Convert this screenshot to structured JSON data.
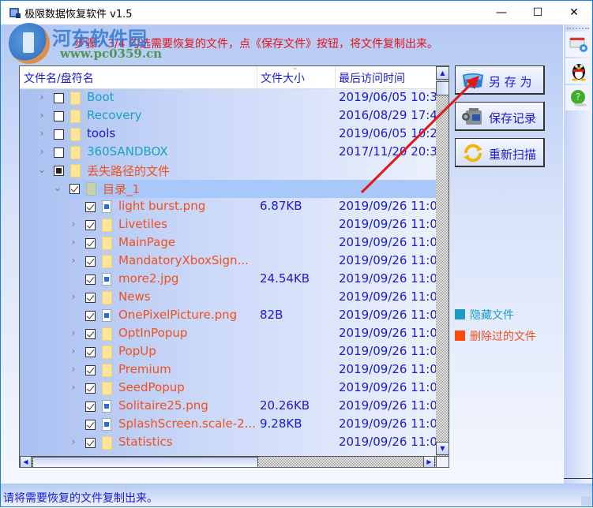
{
  "window": {
    "title": "极限数据恢复软件 v1.5",
    "controls": {
      "minimize": "—",
      "maximize": "☐",
      "close": "✕"
    }
  },
  "watermark": {
    "title": "河东软件园",
    "url": "www.pc0359.cn"
  },
  "step_instruction": "步骤：3/4 勾选需要恢复的文件，点《保存文件》按钮，将文件复制出来。",
  "tree": {
    "columns": [
      "文件名/盘符名",
      "文件大小",
      "最后访问时间"
    ],
    "rows": [
      {
        "level": 0,
        "expander": "collapsed",
        "check": "unchecked",
        "icon": "folder",
        "name": "Boot",
        "color": "hidden",
        "size": "",
        "date": "2019/06/05 10:3"
      },
      {
        "level": 0,
        "expander": "collapsed",
        "check": "unchecked",
        "icon": "folder",
        "name": "Recovery",
        "color": "hidden",
        "size": "",
        "date": "2016/08/29 17:4"
      },
      {
        "level": 0,
        "expander": "collapsed",
        "check": "unchecked",
        "icon": "folder",
        "name": "tools",
        "color": "normal",
        "size": "",
        "date": "2019/06/05 10:2"
      },
      {
        "level": 0,
        "expander": "collapsed",
        "check": "unchecked",
        "icon": "folder",
        "name": "360SANDBOX",
        "color": "hidden",
        "size": "",
        "date": "2017/11/20 20:3"
      },
      {
        "level": 0,
        "expander": "expanded",
        "check": "partial",
        "icon": "folder",
        "name": "丢失路径的文件",
        "color": "deleted",
        "size": "",
        "date": ""
      },
      {
        "level": 1,
        "expander": "expanded",
        "check": "checked",
        "icon": "folder-grey",
        "name": "目录_1",
        "color": "deleted",
        "size": "",
        "date": "",
        "selected": true
      },
      {
        "level": 2,
        "expander": "none",
        "check": "checked",
        "icon": "image",
        "name": "light burst.png",
        "color": "deleted",
        "size": "6.87KB",
        "date": "2019/09/26 11:0"
      },
      {
        "level": 2,
        "expander": "collapsed",
        "check": "checked",
        "icon": "folder",
        "name": "Livetiles",
        "color": "deleted",
        "size": "",
        "date": "2019/09/26 11:0"
      },
      {
        "level": 2,
        "expander": "collapsed",
        "check": "checked",
        "icon": "folder",
        "name": "MainPage",
        "color": "deleted",
        "size": "",
        "date": "2019/09/26 11:0"
      },
      {
        "level": 2,
        "expander": "collapsed",
        "check": "checked",
        "icon": "folder",
        "name": "MandatoryXboxSign...",
        "color": "deleted",
        "size": "",
        "date": "2019/09/26 11:0"
      },
      {
        "level": 2,
        "expander": "none",
        "check": "checked",
        "icon": "image",
        "name": "more2.jpg",
        "color": "deleted",
        "size": "24.54KB",
        "date": "2019/09/26 11:0"
      },
      {
        "level": 2,
        "expander": "collapsed",
        "check": "checked",
        "icon": "folder",
        "name": "News",
        "color": "deleted",
        "size": "",
        "date": "2019/09/26 11:0"
      },
      {
        "level": 2,
        "expander": "none",
        "check": "checked",
        "icon": "image",
        "name": "OnePixelPicture.png",
        "color": "deleted",
        "size": "82B",
        "date": "2019/09/26 11:0"
      },
      {
        "level": 2,
        "expander": "collapsed",
        "check": "checked",
        "icon": "folder",
        "name": "OptInPopup",
        "color": "deleted",
        "size": "",
        "date": "2019/09/26 11:0"
      },
      {
        "level": 2,
        "expander": "collapsed",
        "check": "checked",
        "icon": "folder",
        "name": "PopUp",
        "color": "deleted",
        "size": "",
        "date": "2019/09/26 11:0"
      },
      {
        "level": 2,
        "expander": "collapsed",
        "check": "checked",
        "icon": "folder",
        "name": "Premium",
        "color": "deleted",
        "size": "",
        "date": "2019/09/26 11:0"
      },
      {
        "level": 2,
        "expander": "collapsed",
        "check": "checked",
        "icon": "folder",
        "name": "SeedPopup",
        "color": "deleted",
        "size": "",
        "date": "2019/09/26 11:0"
      },
      {
        "level": 2,
        "expander": "none",
        "check": "checked",
        "icon": "image",
        "name": "Solitaire25.png",
        "color": "deleted",
        "size": "20.26KB",
        "date": "2019/09/26 11:0"
      },
      {
        "level": 2,
        "expander": "none",
        "check": "checked",
        "icon": "image",
        "name": "SplashScreen.scale-2...",
        "color": "deleted",
        "size": "9.28KB",
        "date": "2019/09/26 11:0"
      },
      {
        "level": 2,
        "expander": "collapsed",
        "check": "checked",
        "icon": "folder",
        "name": "Statistics",
        "color": "deleted",
        "size": "",
        "date": "2019/09/26 11:0"
      }
    ]
  },
  "actions": {
    "save_as": {
      "label": "另 存 为",
      "icon": "save-as-icon"
    },
    "save_log": {
      "label": "保存记录",
      "icon": "camcorder-icon"
    },
    "rescan": {
      "label": "重新扫描",
      "icon": "refresh-icon"
    }
  },
  "legend": [
    {
      "label": "隐藏文件",
      "color": "#1aa0c8"
    },
    {
      "label": "删除过的文件",
      "color": "#f0501e"
    }
  ],
  "sidebar": [
    {
      "name": "settings",
      "icon": "settings-icon"
    },
    {
      "name": "qq",
      "icon": "qq-penguin-icon"
    },
    {
      "name": "help",
      "icon": "help-icon"
    }
  ],
  "status": {
    "text": "请将需要恢复的文件复制出来。"
  },
  "colors": {
    "hidden": "#1aa0c8",
    "normal": "#1a1ad0",
    "deleted": "#f0501e",
    "accent": "#1a1ad0"
  }
}
